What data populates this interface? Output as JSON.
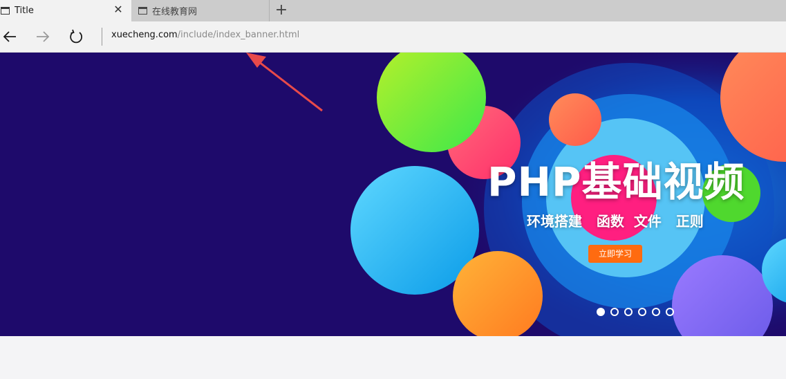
{
  "tabs": [
    {
      "label": "Title",
      "active": true
    },
    {
      "label": "在线教育网",
      "active": false
    }
  ],
  "toolbar": {
    "address_host": "xuecheng.com",
    "address_path": "/include/index_banner.html"
  },
  "banner": {
    "title": "PHP基础视频",
    "subtitle": "环境搭建   函数  文件   正则",
    "button_label": "立即学习",
    "slide_count": 6,
    "active_slide": 1,
    "background_color": "#1e0a6b",
    "button_color": "#ff6b10"
  },
  "annotation": {
    "arrow_color": "#e84a4a"
  },
  "icons": {
    "tab": "tab-page-icon",
    "close": "close-icon",
    "new_tab": "plus-icon",
    "back": "back-arrow-icon",
    "forward": "forward-arrow-icon",
    "refresh": "refresh-icon"
  }
}
